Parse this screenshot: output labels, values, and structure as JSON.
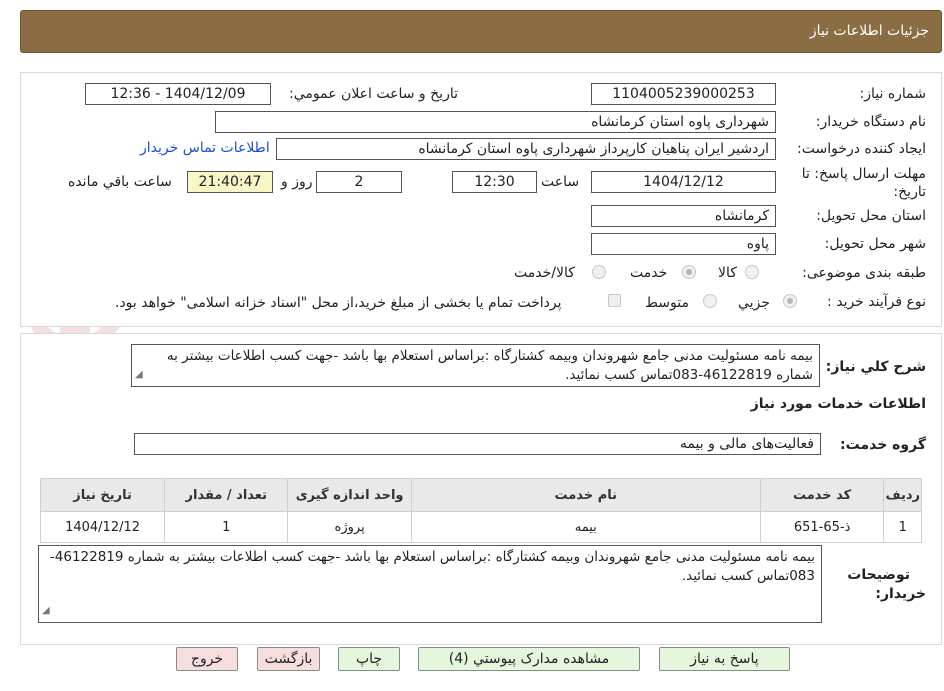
{
  "header": {
    "title": "جزئیات اطلاعات نیاز"
  },
  "form": {
    "need_number": {
      "label": "شماره نیاز:",
      "value": "1104005239000253"
    },
    "announce": {
      "label": "تاریخ و ساعت اعلان عمومي:",
      "value": "1404/12/09 - 12:36"
    },
    "buyer_org": {
      "label": "نام دستگاه خریدار:",
      "value": "شهرداری پاوه استان کرمانشاه"
    },
    "requester": {
      "label": "ایجاد کننده درخواست:",
      "value": "اردشیر ایران پناهیان کارپرداز شهرداری پاوه استان کرمانشاه",
      "contact_link": "اطلاعات تماس خریدار"
    },
    "deadline": {
      "label_line1": "مهلت ارسال پاسخ: تا",
      "label_line2": "تاریخ:",
      "date": "1404/12/12",
      "time_label": "ساعت",
      "time": "12:30",
      "days": "2",
      "days_label": "روز و",
      "remaining": "21:40:47",
      "remaining_label": "ساعت باقي مانده"
    },
    "province": {
      "label": "استان محل تحویل:",
      "value": "کرمانشاه"
    },
    "city": {
      "label": "شهر محل تحویل:",
      "value": "پاوه"
    },
    "category": {
      "label": "طبقه بندی موضوعی:",
      "options": [
        "کالا",
        "خدمت",
        "کالا/خدمت"
      ],
      "selected": "خدمت"
    },
    "purchase_type": {
      "label": "نوع فرآیند خرید :",
      "options": [
        "جزیي",
        "متوسط"
      ],
      "selected": "جزیي",
      "note": "پرداخت تمام یا بخشی از مبلغ خرید،از محل \"اسناد خزانه اسلامی\" خواهد بود."
    }
  },
  "summary": {
    "label": "شرح کلي نیاز:",
    "value": "بیمه نامه مسئولیت مدنی جامع شهروندان وبیمه کشتارگاه :براساس استعلام بها باشد -جهت کسب اطلاعات بیشتر به شماره 46122819-083تماس کسب نمائید."
  },
  "services": {
    "section_title": "اطلاعات خدمات مورد نیاز",
    "group_label": "گروه خدمت:",
    "group_value": "فعالیت‌های مالی و بیمه",
    "columns": [
      "ردیف",
      "کد خدمت",
      "نام خدمت",
      "واحد اندازه گیری",
      "تعداد / مقدار",
      "تاریخ نیاز"
    ],
    "rows": [
      [
        "1",
        "ذ-65-651",
        "بیمه",
        "پروژه",
        "1",
        "1404/12/12"
      ]
    ]
  },
  "buyer_notes": {
    "label_line1": "توضیحات",
    "label_line2": "خریدار:",
    "value": "بیمه نامه مسئولیت مدنی جامع شهروندان وبیمه کشتارگاه :براساس استعلام بها باشد -جهت کسب اطلاعات بیشتر به شماره 46122819-083تماس کسب نمائید."
  },
  "buttons": {
    "reply": "پاسخ به نیاز",
    "attachments": "مشاهده مدارک پیوستي (4)",
    "print": "چاپ",
    "back": "بازگشت",
    "exit": "خروج"
  },
  "colors": {
    "header_bg": "#8b6d44",
    "button_green": "#e4f6dc",
    "button_red": "#f7dede",
    "link": "#1a4fd6"
  }
}
